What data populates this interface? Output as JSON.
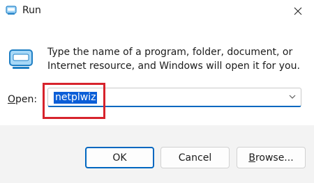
{
  "window": {
    "title": "Run",
    "title_icon": "run-icon",
    "close_icon": "close-icon"
  },
  "dialog": {
    "description": "Type the name of a program, folder, document, or Internet resource, and Windows will open it for you.",
    "open_label_accel": "O",
    "open_label_rest": "pen:",
    "open_value": "netplwiz"
  },
  "buttons": {
    "ok": "OK",
    "cancel": "Cancel",
    "browse_accel": "B",
    "browse_rest": "rowse..."
  },
  "colors": {
    "accent": "#0067c0",
    "highlight": "#d7232c",
    "footer_bg": "#f3f3f3"
  }
}
